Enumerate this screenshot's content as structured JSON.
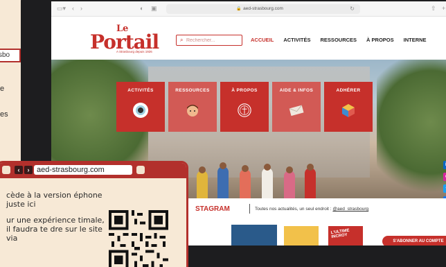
{
  "poster": {
    "strip_text": "sbo",
    "letter_e": "e",
    "letter_es": "es"
  },
  "browser": {
    "url": "aed-strasbourg.com"
  },
  "site": {
    "logo_le": "Le",
    "logo_main": "Portail",
    "logo_tagline": "A Strasbourg depuis 1926",
    "search_placeholder": "Rechercher...",
    "nav": [
      {
        "label": "ACCUEIL",
        "active": true
      },
      {
        "label": "ACTIVITÉS",
        "active": false
      },
      {
        "label": "RESSOURCES",
        "active": false
      },
      {
        "label": "À PROPOS",
        "active": false
      },
      {
        "label": "INTERNE",
        "active": false
      }
    ],
    "tiles": [
      {
        "label": "ACTIVITÉS",
        "icon": "eye-icon"
      },
      {
        "label": "RESSOURCES",
        "icon": "student-head-icon"
      },
      {
        "label": "À PROPOS",
        "icon": "seal-icon"
      },
      {
        "label": "AIDE & INFOS",
        "icon": "envelope-icon"
      },
      {
        "label": "ADHÉRER",
        "icon": "rubiks-cube-icon"
      }
    ],
    "socials": [
      {
        "name": "linkedin-icon",
        "glyph": "in",
        "color": "#0a66c2"
      },
      {
        "name": "instagram-icon",
        "glyph": "◎",
        "color": "#d6249f"
      },
      {
        "name": "twitter-icon",
        "glyph": "✦",
        "color": "#1da1f2"
      },
      {
        "name": "facebook-icon",
        "glyph": "f",
        "color": "#1877f2"
      }
    ],
    "instagram": {
      "title": "STAGRAM",
      "subtitle": "Toutes nos actualités, un seul endroit :",
      "handle": "@aed_strasbourg",
      "card_text": "L'ULTIME INCROY",
      "button": "S'ABONNER AU COMPTE"
    }
  },
  "card": {
    "url": "aed-strasbourg.com",
    "paragraph1": "cède à la version éphone juste ici",
    "paragraph2": "ur une expérience timale, il faudra te dre sur le site via"
  },
  "colors": {
    "brand_red": "#c6302b",
    "card_red": "#b2302c",
    "cream": "#f7e9d6"
  }
}
